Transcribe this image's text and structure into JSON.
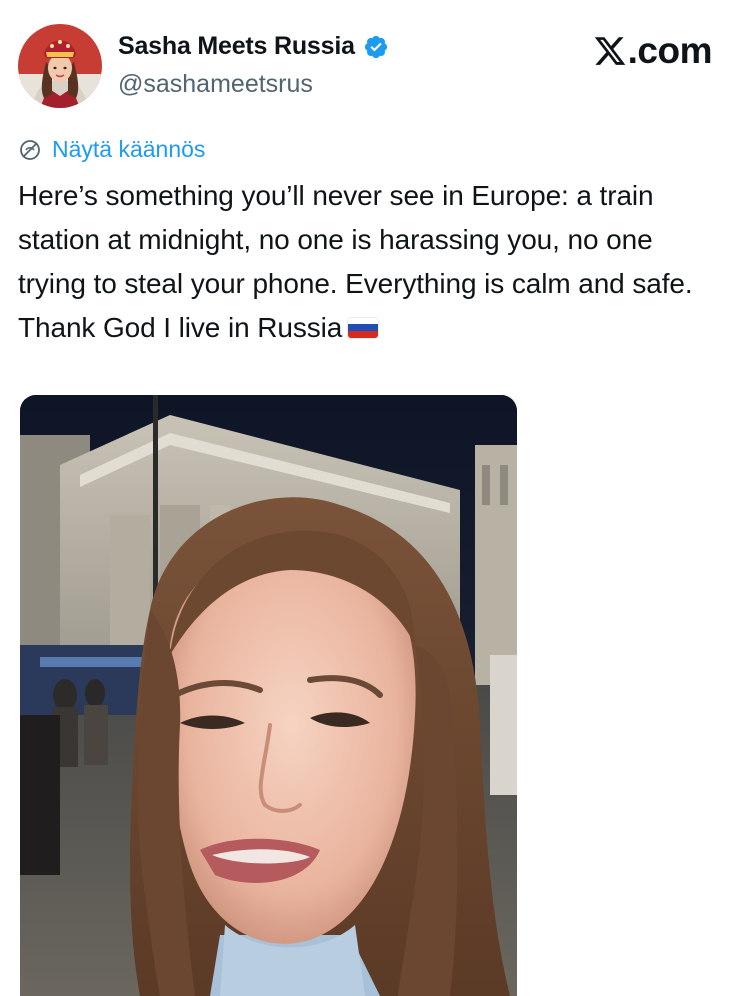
{
  "author": {
    "display_name": "Sasha Meets Russia",
    "handle": "@sashameetsrus",
    "verified": true,
    "avatar_icon": "profile-photo"
  },
  "brand": {
    "label": ".com",
    "icon": "x-logo-icon"
  },
  "translate": {
    "label": "Näytä käännös",
    "icon": "globe-icon"
  },
  "tweet": {
    "text": "Here’s something you’ll never see in Europe: a train station at midnight, no one is harassing you, no one trying to steal your phone. Everything is calm and safe. Thank God I live in Russia",
    "emoji": "russian-flag"
  },
  "colors": {
    "link": "#1d9bf0",
    "text": "#0f1419",
    "secondary": "#536471",
    "verified": "#1d9bf0"
  }
}
